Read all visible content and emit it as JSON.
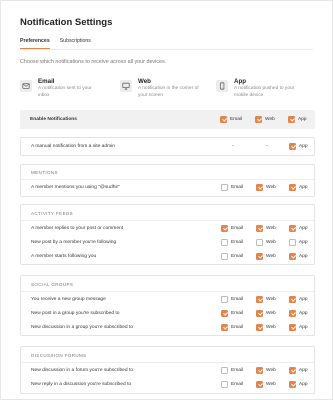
{
  "page": {
    "title": "Notification Settings",
    "intro": "Choose which notifications to receive across all your devices."
  },
  "tabs": [
    {
      "label": "Preferences"
    },
    {
      "label": "Subscriptions"
    }
  ],
  "types": [
    {
      "title": "Email",
      "desc1": "A notification sent to your",
      "desc2": "inbox",
      "icon": "mail-icon"
    },
    {
      "title": "Web",
      "desc1": "A notification in the corner of",
      "desc2": "your screen",
      "icon": "monitor-icon"
    },
    {
      "title": "App",
      "desc1": "A notification pushed to your",
      "desc2": "mobile device",
      "icon": "phone-icon"
    }
  ],
  "options": {
    "email": "Email",
    "web": "Web",
    "app": "App",
    "dash": "-"
  },
  "enable": {
    "label": "Enable Notifications",
    "email": true,
    "web": true,
    "app": true
  },
  "admin": {
    "label": "A manual notification from a site admin",
    "app": true
  },
  "sections": [
    {
      "title": "MENTIONS",
      "rows": [
        {
          "label": "A member mentions you using \"@sudhir\"",
          "email": false,
          "web": true,
          "app": true
        }
      ]
    },
    {
      "title": "ACTIVITY FEEDS",
      "rows": [
        {
          "label": "A member replies to your post or comment",
          "email": true,
          "web": true,
          "app": true
        },
        {
          "label": "New post by a member you're following",
          "email": false,
          "web": false,
          "app": false
        },
        {
          "label": "A member starts following you",
          "email": false,
          "web": true,
          "app": true
        }
      ]
    },
    {
      "title": "SOCIAL GROUPS",
      "rows": [
        {
          "label": "You receive a new group message",
          "email": false,
          "web": true,
          "app": true
        },
        {
          "label": "New post in a group you're subscribed to",
          "email": true,
          "web": true,
          "app": true
        },
        {
          "label": "New discussion in a group you're subscribed to",
          "email": true,
          "web": true,
          "app": true
        }
      ]
    },
    {
      "title": "DISCUSSION FORUMS",
      "rows": [
        {
          "label": "New discussion in a forum you're subscribed to",
          "email": false,
          "web": true,
          "app": true
        },
        {
          "label": "New reply in a discussion you're subscribed to",
          "email": false,
          "web": true,
          "app": true
        }
      ]
    }
  ],
  "colors": {
    "accent": "#e3844a"
  }
}
